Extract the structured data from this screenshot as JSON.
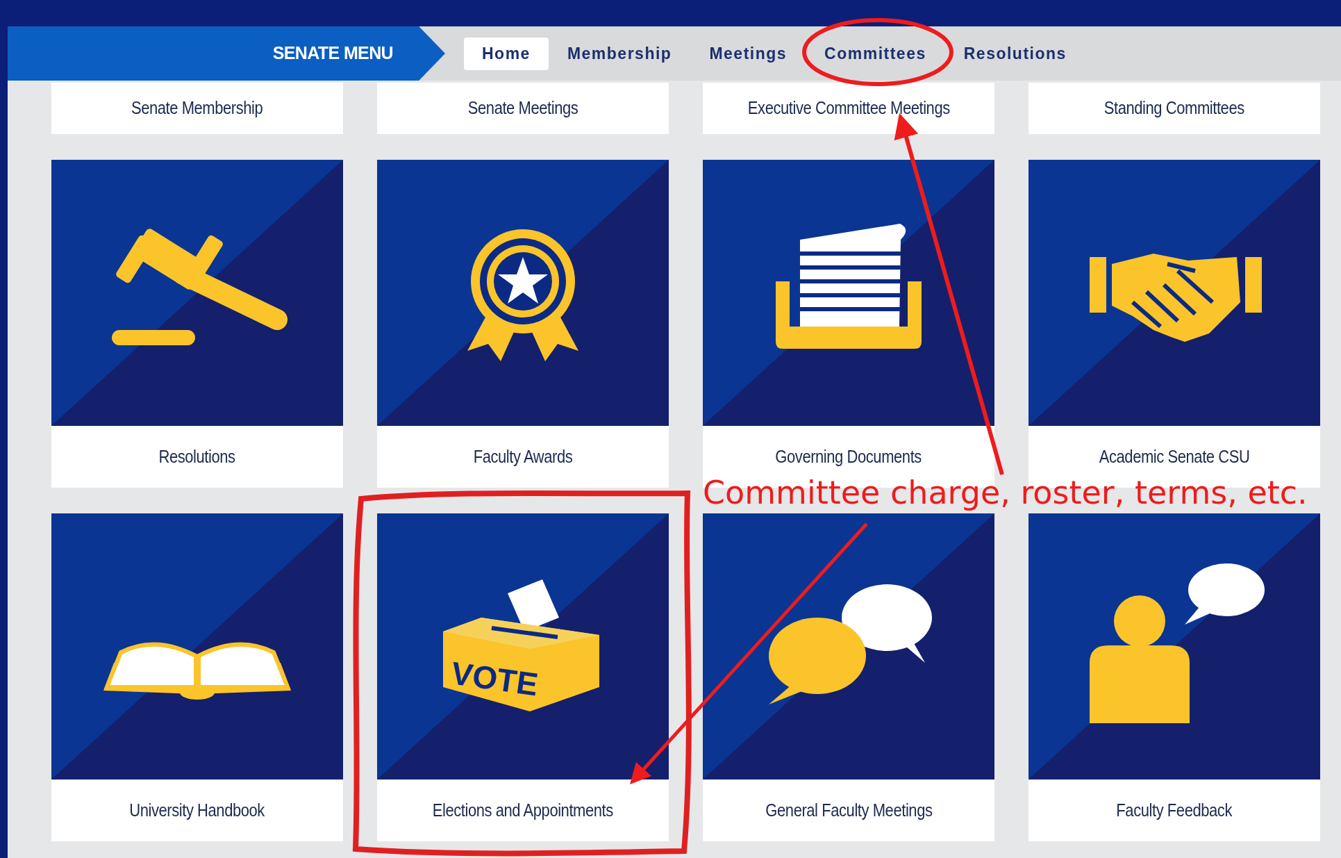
{
  "menu": {
    "title": "SENATE MENU",
    "tabs": [
      {
        "label": "Home",
        "selected": true
      },
      {
        "label": "Membership",
        "selected": false
      },
      {
        "label": "Meetings",
        "selected": false
      },
      {
        "label": "Committees",
        "selected": false
      },
      {
        "label": "Resolutions",
        "selected": false
      }
    ]
  },
  "tiles": [
    {
      "label": "Senate Membership",
      "kind": "label_only"
    },
    {
      "label": "Senate Meetings",
      "kind": "label_only"
    },
    {
      "label": "Executive Committee Meetings",
      "kind": "label_only"
    },
    {
      "label": "Standing Committees",
      "kind": "label_only"
    },
    {
      "label": "Resolutions",
      "kind": "gavel"
    },
    {
      "label": "Faculty Awards",
      "kind": "award"
    },
    {
      "label": "Governing Documents",
      "kind": "documents"
    },
    {
      "label": "Academic Senate CSU",
      "kind": "handshake"
    },
    {
      "label": "University Handbook",
      "kind": "book"
    },
    {
      "label": "Elections and Appointments",
      "kind": "ballot",
      "icon_text": "VOTE"
    },
    {
      "label": "General Faculty Meetings",
      "kind": "speech"
    },
    {
      "label": "Faculty Feedback",
      "kind": "feedback"
    }
  ],
  "annotation": {
    "text": "Committee charge, roster, terms, etc."
  }
}
